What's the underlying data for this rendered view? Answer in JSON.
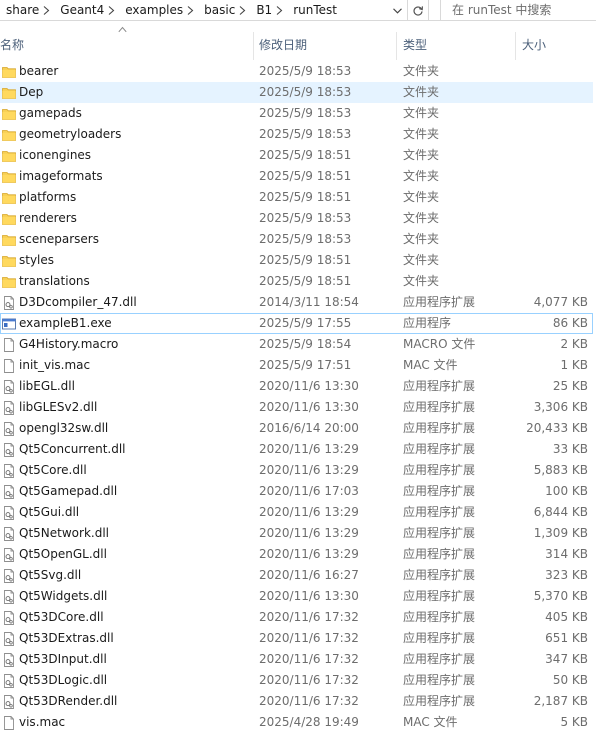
{
  "address": {
    "crumbs": [
      "share",
      "Geant4",
      "examples",
      "basic",
      "B1",
      "runTest"
    ]
  },
  "search": {
    "placeholder": "在 runTest 中搜索"
  },
  "columns": {
    "name": "名称",
    "date": "修改日期",
    "type": "类型",
    "size": "大小"
  },
  "selection": {
    "hover_index": 1,
    "focus_index": 12
  },
  "files": [
    {
      "name": "bearer",
      "date": "2025/5/9 18:53",
      "type": "文件夹",
      "size": "",
      "icon": "folder-icon"
    },
    {
      "name": "Dep",
      "date": "2025/5/9 18:53",
      "type": "文件夹",
      "size": "",
      "icon": "folder-icon"
    },
    {
      "name": "gamepads",
      "date": "2025/5/9 18:53",
      "type": "文件夹",
      "size": "",
      "icon": "folder-icon"
    },
    {
      "name": "geometryloaders",
      "date": "2025/5/9 18:53",
      "type": "文件夹",
      "size": "",
      "icon": "folder-icon"
    },
    {
      "name": "iconengines",
      "date": "2025/5/9 18:51",
      "type": "文件夹",
      "size": "",
      "icon": "folder-icon"
    },
    {
      "name": "imageformats",
      "date": "2025/5/9 18:51",
      "type": "文件夹",
      "size": "",
      "icon": "folder-icon"
    },
    {
      "name": "platforms",
      "date": "2025/5/9 18:51",
      "type": "文件夹",
      "size": "",
      "icon": "folder-icon"
    },
    {
      "name": "renderers",
      "date": "2025/5/9 18:53",
      "type": "文件夹",
      "size": "",
      "icon": "folder-icon"
    },
    {
      "name": "sceneparsers",
      "date": "2025/5/9 18:53",
      "type": "文件夹",
      "size": "",
      "icon": "folder-icon"
    },
    {
      "name": "styles",
      "date": "2025/5/9 18:51",
      "type": "文件夹",
      "size": "",
      "icon": "folder-icon"
    },
    {
      "name": "translations",
      "date": "2025/5/9 18:51",
      "type": "文件夹",
      "size": "",
      "icon": "folder-icon"
    },
    {
      "name": "D3Dcompiler_47.dll",
      "date": "2014/3/11 18:54",
      "type": "应用程序扩展",
      "size": "4,077 KB",
      "icon": "dll-file-icon"
    },
    {
      "name": "exampleB1.exe",
      "date": "2025/5/9 17:55",
      "type": "应用程序",
      "size": "86 KB",
      "icon": "exe-file-icon"
    },
    {
      "name": "G4History.macro",
      "date": "2025/5/9 18:54",
      "type": "MACRO 文件",
      "size": "2 KB",
      "icon": "file-icon"
    },
    {
      "name": "init_vis.mac",
      "date": "2025/5/9 17:51",
      "type": "MAC 文件",
      "size": "1 KB",
      "icon": "file-icon"
    },
    {
      "name": "libEGL.dll",
      "date": "2020/11/6 13:30",
      "type": "应用程序扩展",
      "size": "25 KB",
      "icon": "dll-file-icon"
    },
    {
      "name": "libGLESv2.dll",
      "date": "2020/11/6 13:30",
      "type": "应用程序扩展",
      "size": "3,306 KB",
      "icon": "dll-file-icon"
    },
    {
      "name": "opengl32sw.dll",
      "date": "2016/6/14 20:00",
      "type": "应用程序扩展",
      "size": "20,433 KB",
      "icon": "dll-file-icon"
    },
    {
      "name": "Qt5Concurrent.dll",
      "date": "2020/11/6 13:29",
      "type": "应用程序扩展",
      "size": "33 KB",
      "icon": "dll-file-icon"
    },
    {
      "name": "Qt5Core.dll",
      "date": "2020/11/6 13:29",
      "type": "应用程序扩展",
      "size": "5,883 KB",
      "icon": "dll-file-icon"
    },
    {
      "name": "Qt5Gamepad.dll",
      "date": "2020/11/6 17:03",
      "type": "应用程序扩展",
      "size": "100 KB",
      "icon": "dll-file-icon"
    },
    {
      "name": "Qt5Gui.dll",
      "date": "2020/11/6 13:29",
      "type": "应用程序扩展",
      "size": "6,844 KB",
      "icon": "dll-file-icon"
    },
    {
      "name": "Qt5Network.dll",
      "date": "2020/11/6 13:29",
      "type": "应用程序扩展",
      "size": "1,309 KB",
      "icon": "dll-file-icon"
    },
    {
      "name": "Qt5OpenGL.dll",
      "date": "2020/11/6 13:29",
      "type": "应用程序扩展",
      "size": "314 KB",
      "icon": "dll-file-icon"
    },
    {
      "name": "Qt5Svg.dll",
      "date": "2020/11/6 16:27",
      "type": "应用程序扩展",
      "size": "323 KB",
      "icon": "dll-file-icon"
    },
    {
      "name": "Qt5Widgets.dll",
      "date": "2020/11/6 13:30",
      "type": "应用程序扩展",
      "size": "5,370 KB",
      "icon": "dll-file-icon"
    },
    {
      "name": "Qt53DCore.dll",
      "date": "2020/11/6 17:32",
      "type": "应用程序扩展",
      "size": "405 KB",
      "icon": "dll-file-icon"
    },
    {
      "name": "Qt53DExtras.dll",
      "date": "2020/11/6 17:32",
      "type": "应用程序扩展",
      "size": "651 KB",
      "icon": "dll-file-icon"
    },
    {
      "name": "Qt53DInput.dll",
      "date": "2020/11/6 17:32",
      "type": "应用程序扩展",
      "size": "347 KB",
      "icon": "dll-file-icon"
    },
    {
      "name": "Qt53DLogic.dll",
      "date": "2020/11/6 17:32",
      "type": "应用程序扩展",
      "size": "50 KB",
      "icon": "dll-file-icon"
    },
    {
      "name": "Qt53DRender.dll",
      "date": "2020/11/6 17:32",
      "type": "应用程序扩展",
      "size": "2,187 KB",
      "icon": "dll-file-icon"
    },
    {
      "name": "vis.mac",
      "date": "2025/4/28 19:49",
      "type": "MAC 文件",
      "size": "5 KB",
      "icon": "file-icon"
    }
  ]
}
